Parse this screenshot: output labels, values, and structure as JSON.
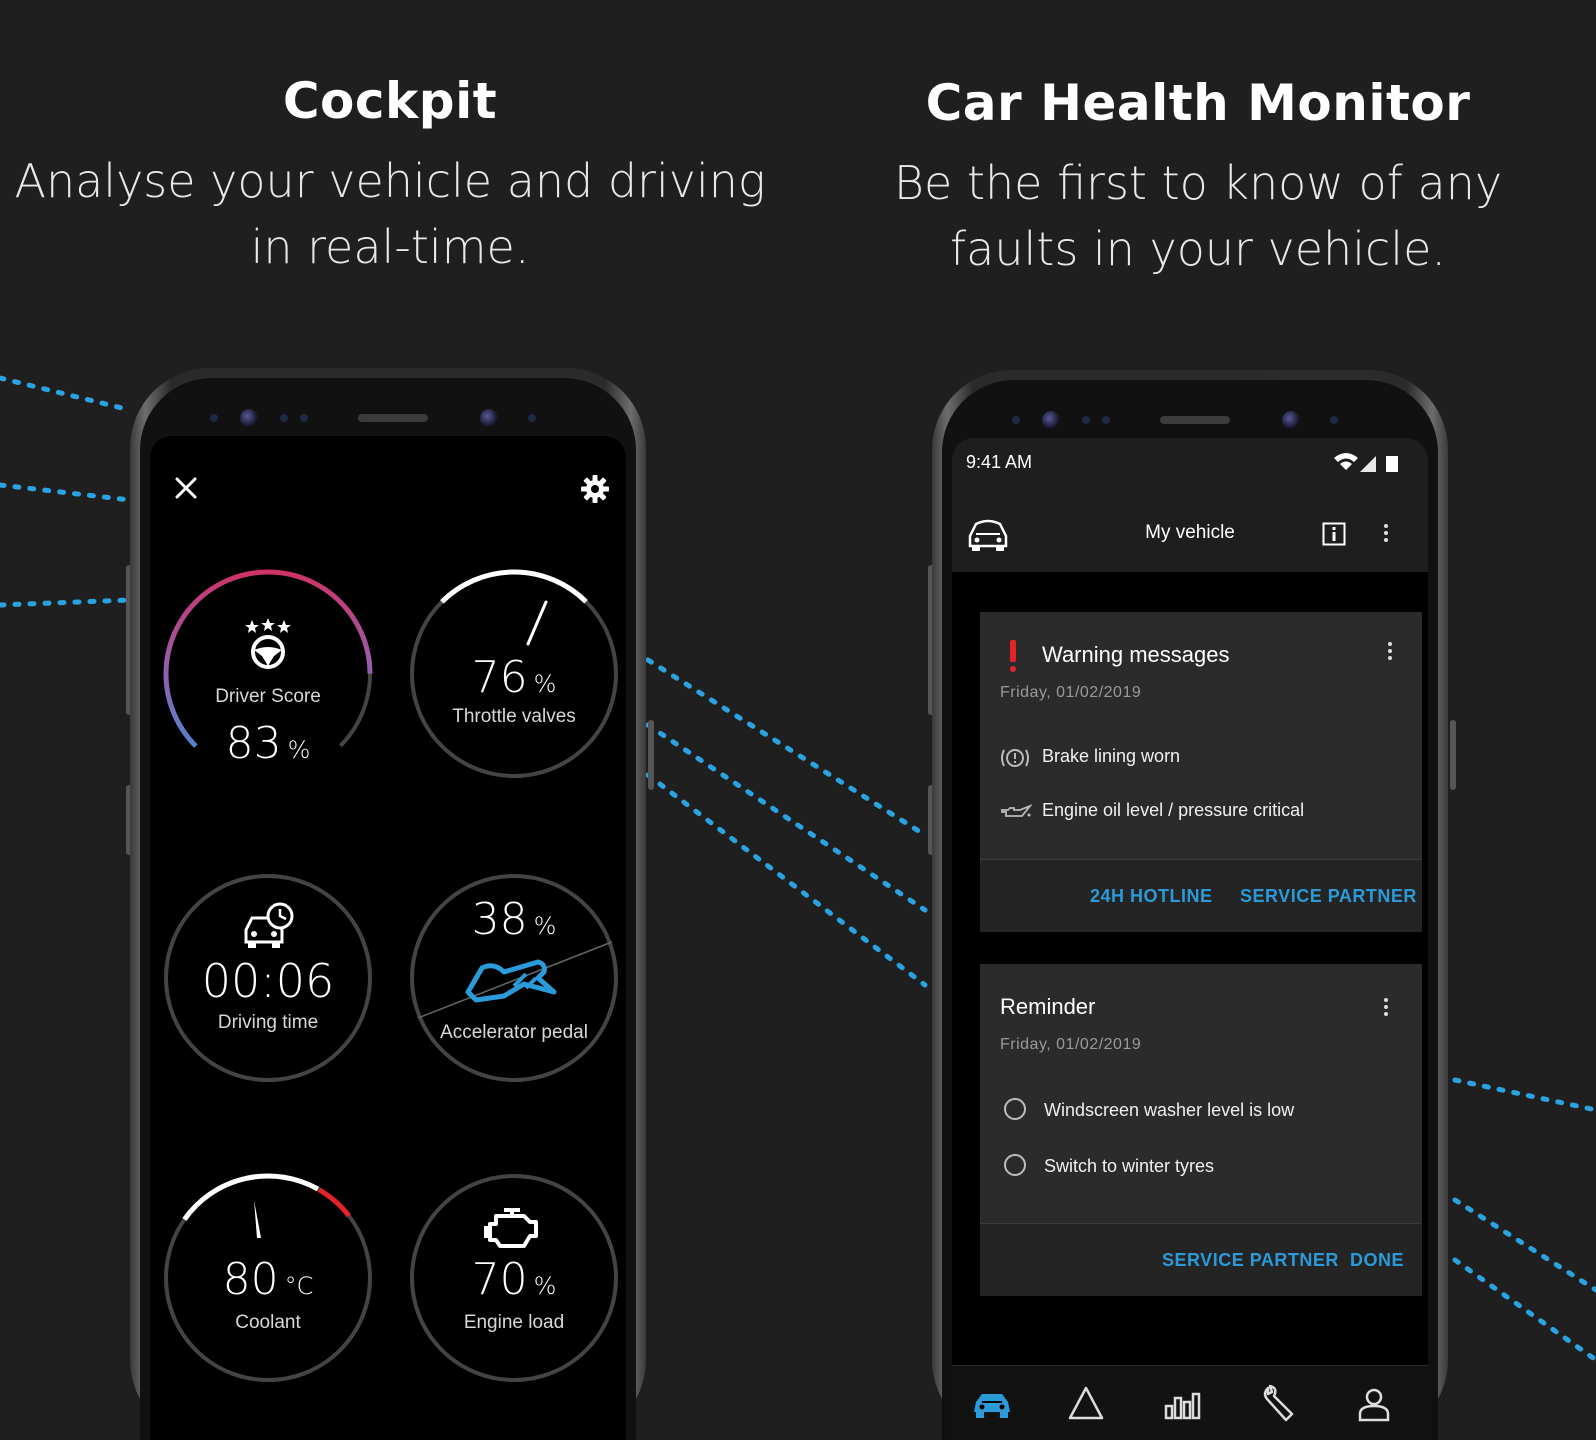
{
  "left_panel": {
    "title": "Cockpit",
    "subtitle_line1": "Analyse your vehicle and driving",
    "subtitle_line2": "in real-time.",
    "screen": {
      "close_icon": "close-icon",
      "settings_icon": "gear-icon",
      "gauges": [
        {
          "key": "driver_score",
          "label": "Driver Score",
          "value": "83",
          "unit": "%",
          "level": 0.83,
          "icon": "steering-wheel-stars-icon"
        },
        {
          "key": "throttle",
          "label": "Throttle valves",
          "value": "76",
          "unit": "%",
          "level": 0.76
        },
        {
          "key": "driving_time",
          "label": "Driving time",
          "value": "00:06",
          "unit": "",
          "icon": "car-clock-icon"
        },
        {
          "key": "accelerator",
          "label": "Accelerator pedal",
          "value": "38",
          "unit": "%",
          "level": 0.38,
          "icon": "pedal-icon"
        },
        {
          "key": "coolant",
          "label": "Coolant",
          "value": "80",
          "unit": "°C"
        },
        {
          "key": "engine_load",
          "label": "Engine load",
          "value": "70",
          "unit": "%",
          "level": 0.7,
          "icon": "engine-icon"
        }
      ]
    }
  },
  "right_panel": {
    "title": "Car Health Monitor",
    "subtitle_line1": "Be the first to know of any",
    "subtitle_line2": "faults in your vehicle.",
    "screen": {
      "status_time": "9:41 AM",
      "appbar_title": "My vehicle",
      "warning_card": {
        "title": "Warning messages",
        "date": "Friday, 01/02/2019",
        "items": [
          "Brake lining worn",
          "Engine oil level / pressure critical"
        ],
        "actions": [
          "24H HOTLINE",
          "SERVICE PARTNER"
        ]
      },
      "reminder_card": {
        "title": "Reminder",
        "date": "Friday, 01/02/2019",
        "items": [
          "Windscreen washer level is low",
          "Switch to winter tyres"
        ],
        "actions": [
          "SERVICE PARTNER",
          "DONE"
        ]
      },
      "nav_icons": [
        "car-icon",
        "navigation-icon",
        "stats-icon",
        "wrench-icon",
        "profile-icon"
      ]
    }
  },
  "colors": {
    "background": "#1f1f1f",
    "accent_blue": "#2a9bd8",
    "warning_red": "#e0242a"
  }
}
